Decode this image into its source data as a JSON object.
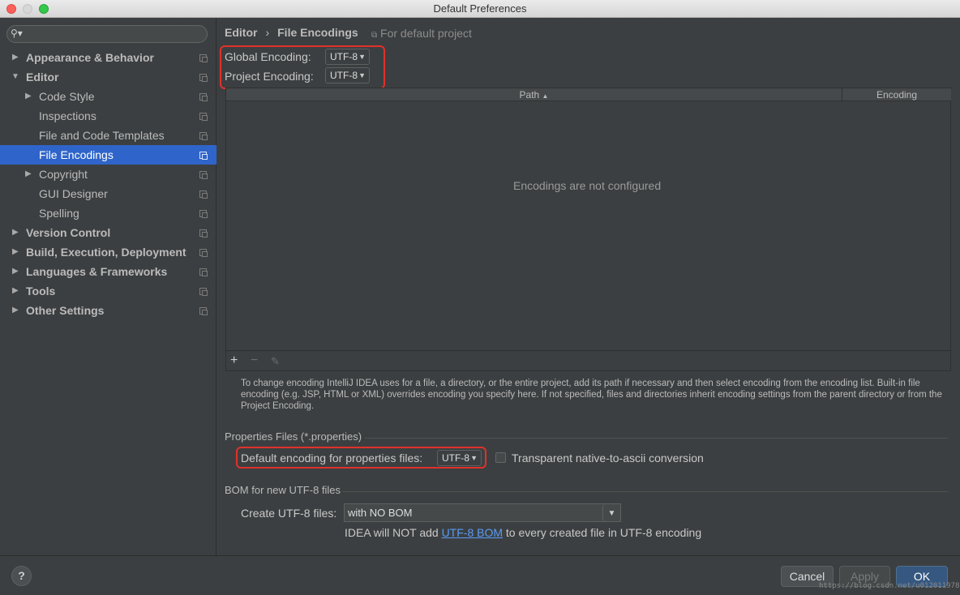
{
  "window": {
    "title": "Default Preferences"
  },
  "search": {
    "placeholder": ""
  },
  "sidebar": {
    "items": [
      {
        "label": "Appearance & Behavior"
      },
      {
        "label": "Editor"
      },
      {
        "label": "Code Style"
      },
      {
        "label": "Inspections"
      },
      {
        "label": "File and Code Templates"
      },
      {
        "label": "File Encodings"
      },
      {
        "label": "Copyright"
      },
      {
        "label": "GUI Designer"
      },
      {
        "label": "Spelling"
      },
      {
        "label": "Version Control"
      },
      {
        "label": "Build, Execution, Deployment"
      },
      {
        "label": "Languages & Frameworks"
      },
      {
        "label": "Tools"
      },
      {
        "label": "Other Settings"
      }
    ]
  },
  "breadcrumb": {
    "parent": "Editor",
    "separator": "›",
    "current": "File Encodings",
    "scope": "For default project"
  },
  "encodings": {
    "global_label": "Global Encoding:",
    "global_value": "UTF-8",
    "project_label": "Project Encoding:",
    "project_value": "UTF-8"
  },
  "table": {
    "col_path": "Path",
    "col_encoding": "Encoding",
    "empty": "Encodings are not configured"
  },
  "help_text": "To change encoding IntelliJ IDEA uses for a file, a directory, or the entire project, add its path if necessary and then select encoding from the encoding list. Built-in file encoding (e.g. JSP, HTML or XML) overrides encoding you specify here. If not specified, files and directories inherit encoding settings from the parent directory or from the Project Encoding.",
  "properties": {
    "section": "Properties Files (*.properties)",
    "default_label": "Default encoding for properties files:",
    "default_value": "UTF-8",
    "transparent_label": "Transparent native-to-ascii conversion"
  },
  "bom": {
    "section": "BOM for new UTF-8 files",
    "create_label": "Create UTF-8 files:",
    "create_value": "with NO BOM",
    "note_prefix": "IDEA will NOT add",
    "note_link": "UTF-8 BOM",
    "note_suffix": "to every created file in UTF-8 encoding"
  },
  "footer": {
    "help": "?",
    "cancel": "Cancel",
    "apply": "Apply",
    "ok": "OK",
    "watermark": "https://blog.csdn.net/u012011978"
  },
  "colors": {
    "selection": "#2f65ca",
    "highlight_box": "#e0312b",
    "link": "#589df6",
    "ok_button": "#365880"
  }
}
